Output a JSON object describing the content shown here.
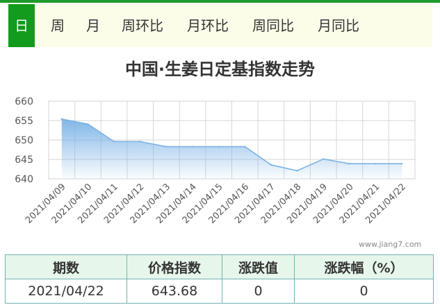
{
  "tabs": [
    {
      "label": "日",
      "active": true
    },
    {
      "label": "周"
    },
    {
      "label": "月"
    },
    {
      "label": "周环比"
    },
    {
      "label": "月环比"
    },
    {
      "label": "周同比"
    },
    {
      "label": "月同比"
    }
  ],
  "colors": {
    "accent": "#129b1c",
    "tab_bg": "#fcfde9",
    "line": "#7ab2e6",
    "table_header_bg": "#e7f6ea",
    "table_border": "#6fb1b3"
  },
  "chart_data": {
    "type": "area",
    "title": "中国·生姜日定基指数走势",
    "x": [
      "2021/04/09",
      "2021/04/10",
      "2021/04/11",
      "2021/04/12",
      "2021/04/13",
      "2021/04/14",
      "2021/04/15",
      "2021/04/16",
      "2021/04/17",
      "2021/04/18",
      "2021/04/19",
      "2021/04/20",
      "2021/04/21",
      "2021/04/22"
    ],
    "series": [
      {
        "values": [
          655.4,
          654.1,
          649.6,
          649.6,
          648.3,
          648.3,
          648.3,
          648.3,
          643.6,
          642.1,
          645.1,
          643.9,
          643.9,
          643.9
        ]
      }
    ],
    "ylim": [
      640,
      660
    ],
    "yticks": [
      640,
      645,
      650,
      655,
      660
    ],
    "grid": true,
    "xlabel": "",
    "ylabel": ""
  },
  "watermark": "www.jiang7.com",
  "table": {
    "headers": [
      "期数",
      "价格指数",
      "涨跌值",
      "涨跌幅（%）"
    ],
    "rows": [
      [
        "2021/04/22",
        "643.68",
        "0",
        "0"
      ]
    ]
  }
}
